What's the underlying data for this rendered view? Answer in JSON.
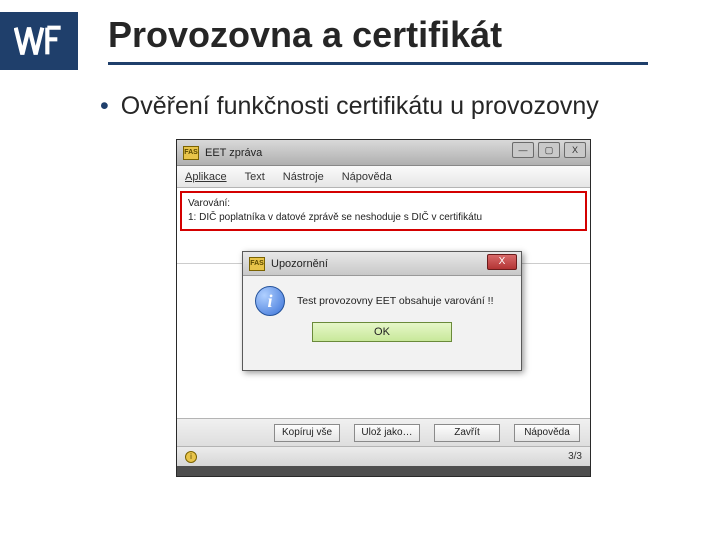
{
  "logo_text": "WF",
  "slide_title": "Provozovna a certifikát",
  "bullet_text": "Ověření funkčnosti certifikátu u provozovny",
  "outer_window": {
    "icon_label": "FAS",
    "title": "EET zpráva",
    "win_min": "—",
    "win_max": "▢",
    "win_close": "X",
    "menu": [
      "Aplikace",
      "Text",
      "Nástroje",
      "Nápověda"
    ],
    "warning_heading": "Varování:",
    "warning_text": "1: DIČ poplatníka v datové zprávě se neshoduje s DIČ v certifikátu",
    "buttons": {
      "copy_all": "Kopíruj vše",
      "save_as": "Ulož jako…",
      "close": "Zavřít",
      "help": "Nápověda"
    },
    "status_icon": "i",
    "status_page": "3/3"
  },
  "dialog": {
    "icon_label": "FAS",
    "title": "Upozornění",
    "close_glyph": "X",
    "info_glyph": "i",
    "message": "Test provozovny EET obsahuje varování !!",
    "ok_label": "OK"
  }
}
